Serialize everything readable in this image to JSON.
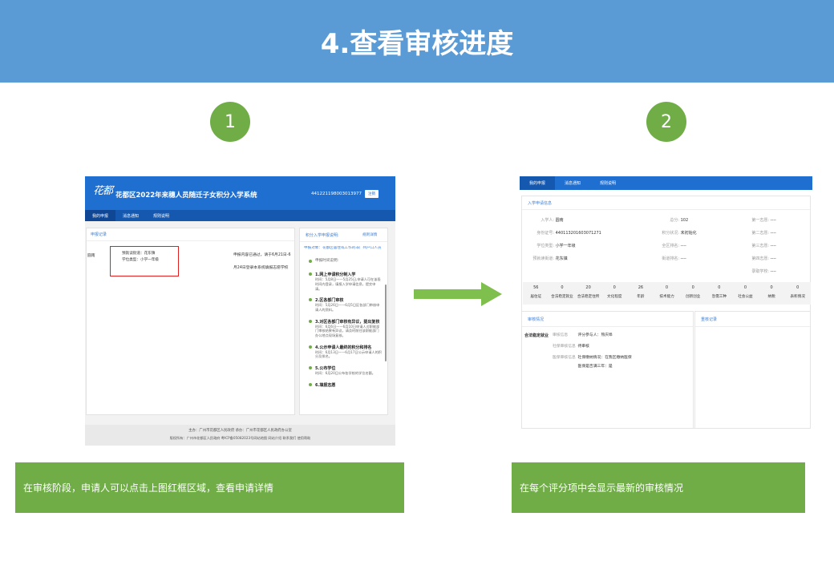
{
  "title": "4.查看审核进度",
  "steps": [
    "1",
    "2"
  ],
  "captions": [
    "在审核阶段，申请人可以点击上图红框区域，查看申请详情",
    "在每个评分项中会显示最新的审核情况"
  ],
  "colors": {
    "banner": "#5b9bd5",
    "green": "#70ad47",
    "nav_blue": "#1f6fd1",
    "highlight_red": "#e02020"
  },
  "shot1": {
    "logo_text": "花都",
    "system_title": "花都区2022年来穗人员随迁子女积分入学系统",
    "id_number": "441221198003013977",
    "logout": "注销",
    "nav": [
      "我的申报",
      "消息通知",
      "规则说明"
    ],
    "records_title": "申报记录",
    "record_name": "圆南",
    "record_line1": "预就读街道：花东镇",
    "record_line2": "学位类型：小学一年级",
    "notice_line1": "申报内容已通过，请于6月21日-6",
    "notice_line2": "月24日登录本系统填报志愿学校",
    "right_title": "积分入学申报说明:",
    "right_link": "规则详情",
    "right_target": "申报对象：花都区居住或工作的非广州户口人员",
    "timeline_head": "申报时间说明:",
    "timeline": [
      {
        "title": "1.网上申请积分制入学",
        "desc": "时间：5月8日——5月25日,申请人可在该段时间内登录，填报入学申请信息，提交申请。"
      },
      {
        "title": "2.区各部门审核",
        "desc": "时间：5月26日——6月5日区各部门审核申请人的资料。"
      },
      {
        "title": "3.对区各部门审核有异议，提出复核",
        "desc": "时间：6月6日——6月10日申请人对职能部门审核结果有异议，请及时前往该职能部门办公地点现场复核。"
      },
      {
        "title": "4.公示申请人最终的积分和排名",
        "desc": "时间：6月13日——6月17日公示申请人的积分及排名。"
      },
      {
        "title": "5.公布学位",
        "desc": "时间：6月20日公布各学校的学位名额。"
      },
      {
        "title": "6.填报志愿",
        "desc": ""
      }
    ],
    "footer1": "主办：广州市花都区人民政府   承办：广州市花都区人民政府办公室",
    "footer2": "版权所有：广州市花都区人民政府 粤ICP备05082023号网站地图 网站介绍 联系我们 使用帮助"
  },
  "shot2": {
    "nav": [
      "我的申报",
      "消息通知",
      "规则说明"
    ],
    "section_title": "入学申请信息",
    "info": [
      {
        "label": "入学人:",
        "value": "圆南"
      },
      {
        "label": "身份证号:",
        "value": "440113201603071271"
      },
      {
        "label": "学位类型:",
        "value": "小学一年级"
      },
      {
        "label": "预就读街道:",
        "value": "花东镇"
      }
    ],
    "info_mid": [
      {
        "label": "总分:",
        "value": "102"
      },
      {
        "label": "积分状况:",
        "value": "未初始化"
      },
      {
        "label": "全区排名:",
        "value": "----"
      },
      {
        "label": "街道排名:",
        "value": "----"
      }
    ],
    "info_right": [
      {
        "label": "第一志愿:",
        "value": "----"
      },
      {
        "label": "第二志愿:",
        "value": "----"
      },
      {
        "label": "第三志愿:",
        "value": "----"
      },
      {
        "label": "第四志愿:",
        "value": "----"
      },
      {
        "label": "录取学校:",
        "value": "----"
      }
    ],
    "scores": [
      {
        "v": "56",
        "n": "居住证"
      },
      {
        "v": "0",
        "n": "合法稳定就业"
      },
      {
        "v": "20",
        "n": "合法稳定住所"
      },
      {
        "v": "0",
        "n": "文化程度"
      },
      {
        "v": "26",
        "n": "年龄"
      },
      {
        "v": "0",
        "n": "技术能力"
      },
      {
        "v": "0",
        "n": "创新创业"
      },
      {
        "v": "0",
        "n": "急需工种"
      },
      {
        "v": "0",
        "n": "社会公益"
      },
      {
        "v": "0",
        "n": "纳税"
      },
      {
        "v": "0",
        "n": "表彰情况"
      }
    ],
    "review_title": "审核情况",
    "modify_title": "重核记录",
    "review_item_title": "合法稳定就业",
    "review_rows": [
      {
        "label": "审核信息",
        "text": "评分参与人：熊庆埠"
      },
      {
        "label": "社保审核信息",
        "text": "待审核"
      },
      {
        "label": "医保审核信息",
        "text": "社保缴纳情况：在我区缴纳医保"
      },
      {
        "label": "",
        "text": "医保是否满三年：是"
      }
    ]
  }
}
